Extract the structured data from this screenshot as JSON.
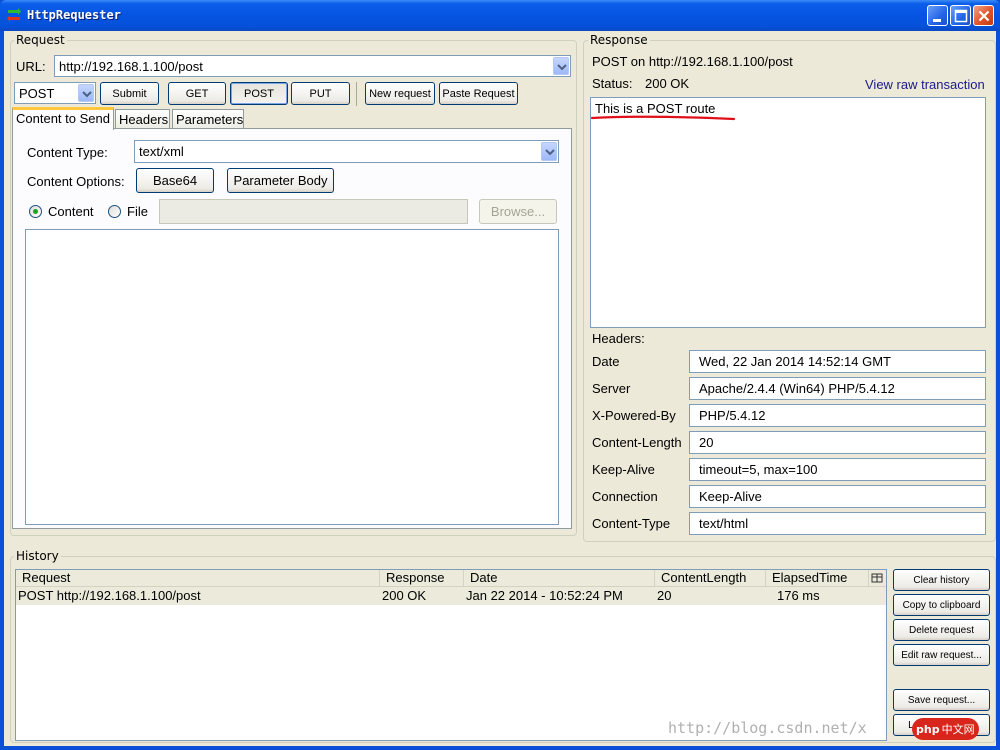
{
  "window": {
    "title": "HttpRequester"
  },
  "request": {
    "group_label": "Request",
    "url_label": "URL:",
    "url_value": "http://192.168.1.100/post",
    "method_value": "POST",
    "buttons": {
      "submit": "Submit",
      "get": "GET",
      "post": "POST",
      "put": "PUT",
      "new_request": "New request",
      "paste_request": "Paste Request"
    },
    "tabs": [
      "Content to Send",
      "Headers",
      "Parameters"
    ],
    "content_type_label": "Content Type:",
    "content_type_value": "text/xml",
    "content_options_label": "Content Options:",
    "base64": "Base64",
    "parameter_body": "Parameter Body",
    "radio_content": "Content",
    "radio_file": "File",
    "browse": "Browse..."
  },
  "response": {
    "group_label": "Response",
    "summary": "POST on http://192.168.1.100/post",
    "status_label": "Status:",
    "status_value": "200 OK",
    "view_raw": "View raw transaction",
    "body": "This is a POST route",
    "headers_label": "Headers:",
    "headers": [
      {
        "name": "Date",
        "value": "Wed, 22 Jan 2014 14:52:14 GMT"
      },
      {
        "name": "Server",
        "value": "Apache/2.4.4 (Win64) PHP/5.4.12"
      },
      {
        "name": "X-Powered-By",
        "value": "PHP/5.4.12"
      },
      {
        "name": "Content-Length",
        "value": "20"
      },
      {
        "name": "Keep-Alive",
        "value": "timeout=5, max=100"
      },
      {
        "name": "Connection",
        "value": "Keep-Alive"
      },
      {
        "name": "Content-Type",
        "value": "text/html"
      }
    ]
  },
  "history": {
    "group_label": "History",
    "columns": [
      "Request",
      "Response",
      "Date",
      "ContentLength",
      "ElapsedTime"
    ],
    "rows": [
      {
        "request": "POST http://192.168.1.100/post",
        "response": "200 OK",
        "date": "Jan 22 2014 - 10:52:24 PM",
        "length": "20",
        "elapsed": "176 ms"
      }
    ],
    "buttons": {
      "clear": "Clear history",
      "copy": "Copy to clipboard",
      "delete": "Delete request",
      "edit_raw": "Edit raw request...",
      "save": "Save request...",
      "load": "Load request..."
    }
  },
  "watermark": "http://blog.csdn.net/x",
  "watermark_badge": "php",
  "watermark_badge_text": "中文网",
  "colors": {
    "title_blue": "#0654e2",
    "link_blue": "#1a1a8c",
    "annotation_red": "#e0101a",
    "selected_row": "#ecebdb"
  }
}
